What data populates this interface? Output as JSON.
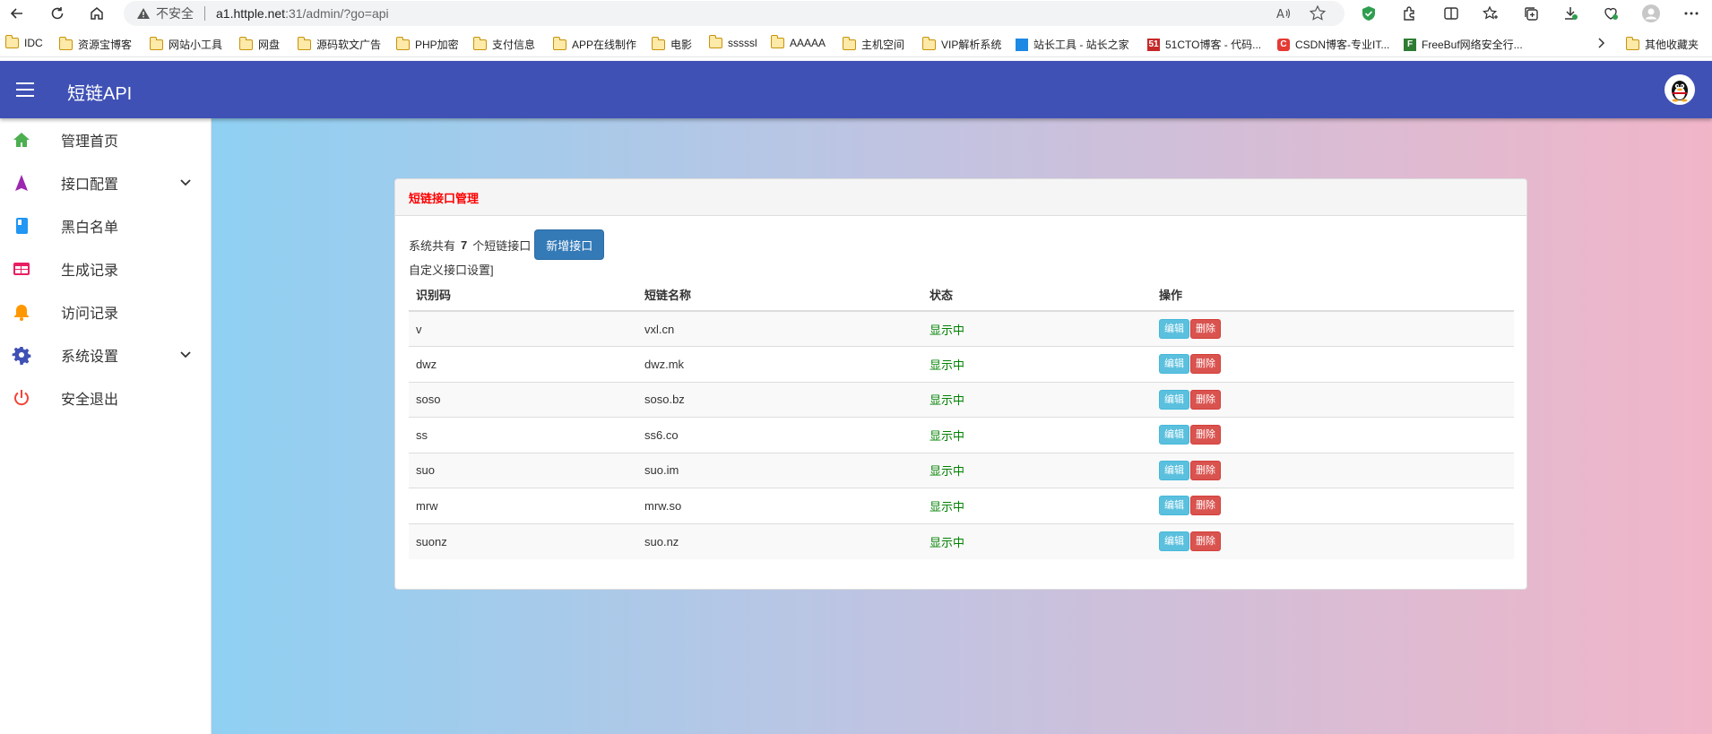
{
  "browser": {
    "url_warning": "不安全",
    "url_host": "a1.httple.net",
    "url_path": ":31/admin/?go=api",
    "bookmarks": [
      {
        "label": "IDC",
        "type": "folder"
      },
      {
        "label": "资源宝博客",
        "type": "folder"
      },
      {
        "label": "网站小工具",
        "type": "folder"
      },
      {
        "label": "网盘",
        "type": "folder"
      },
      {
        "label": "源码软文广告",
        "type": "folder"
      },
      {
        "label": "PHP加密",
        "type": "folder"
      },
      {
        "label": "支付信息",
        "type": "folder"
      },
      {
        "label": "APP在线制作",
        "type": "folder"
      },
      {
        "label": "电影",
        "type": "folder"
      },
      {
        "label": "sssssl",
        "type": "folder"
      },
      {
        "label": "AAAAA",
        "type": "folder"
      },
      {
        "label": "主机空间",
        "type": "folder"
      },
      {
        "label": "VIP解析系统",
        "type": "folder"
      },
      {
        "label": "站长工具 - 站长之家",
        "type": "site"
      },
      {
        "label": "51CTO博客 - 代码...",
        "type": "site"
      },
      {
        "label": "CSDN博客-专业IT...",
        "type": "site"
      },
      {
        "label": "FreeBuf网络安全行...",
        "type": "site"
      },
      {
        "label": "其他收藏夹",
        "type": "folder"
      }
    ]
  },
  "app": {
    "title": "短链API"
  },
  "sidebar": {
    "items": [
      {
        "label": "管理首页",
        "icon": "home-icon",
        "color": "#4caf50"
      },
      {
        "label": "接口配置",
        "icon": "navigation-icon",
        "color": "#9c27b0",
        "expandable": true
      },
      {
        "label": "黑白名单",
        "icon": "book-icon",
        "color": "#2196f3"
      },
      {
        "label": "生成记录",
        "icon": "web-icon",
        "color": "#e91e63"
      },
      {
        "label": "访问记录",
        "icon": "bell-icon",
        "color": "#ff9800"
      },
      {
        "label": "系统设置",
        "icon": "gear-icon",
        "color": "#3f51b5",
        "expandable": true
      },
      {
        "label": "安全退出",
        "icon": "power-icon",
        "color": "#f44336"
      }
    ]
  },
  "panel": {
    "title": "短链接口管理",
    "summary_prefix": "系统共有",
    "summary_count": "7",
    "summary_suffix": "个短链接口",
    "add_button": "新增接口",
    "custom_note": "自定义接口设置]",
    "columns": [
      "识别码",
      "短链名称",
      "状态",
      "操作"
    ],
    "edit_label": "编辑",
    "delete_label": "删除",
    "rows": [
      {
        "code": "v",
        "name": "vxl.cn",
        "status": "显示中"
      },
      {
        "code": "dwz",
        "name": "dwz.mk",
        "status": "显示中"
      },
      {
        "code": "soso",
        "name": "soso.bz",
        "status": "显示中"
      },
      {
        "code": "ss",
        "name": "ss6.co",
        "status": "显示中"
      },
      {
        "code": "suo",
        "name": "suo.im",
        "status": "显示中"
      },
      {
        "code": "mrw",
        "name": "mrw.so",
        "status": "显示中"
      },
      {
        "code": "suonz",
        "name": "suo.nz",
        "status": "显示中"
      }
    ]
  }
}
